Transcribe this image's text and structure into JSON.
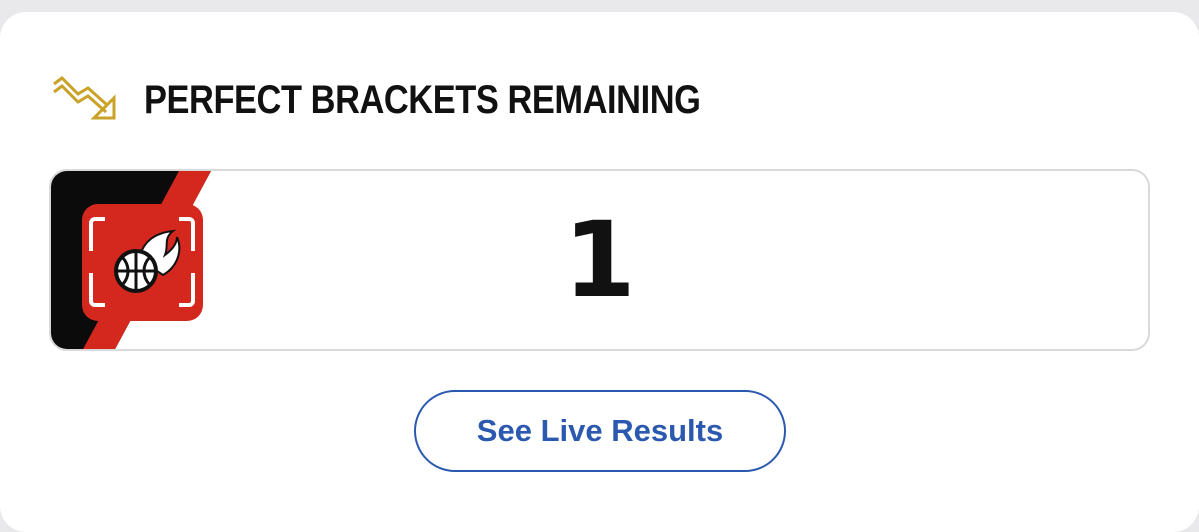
{
  "header": {
    "icon": "trending-down-icon",
    "title": "PERFECT BRACKETS REMAINING"
  },
  "counter": {
    "logo_icon": "flaming-basketball-app-icon",
    "value": "1"
  },
  "cta": {
    "label": "See Live Results"
  },
  "colors": {
    "accent_gold": "#c9a227",
    "logo_red": "#d4281f",
    "logo_black": "#0b0b0b",
    "button_blue": "#2b59b0",
    "border_gray": "#d9d9d9"
  }
}
